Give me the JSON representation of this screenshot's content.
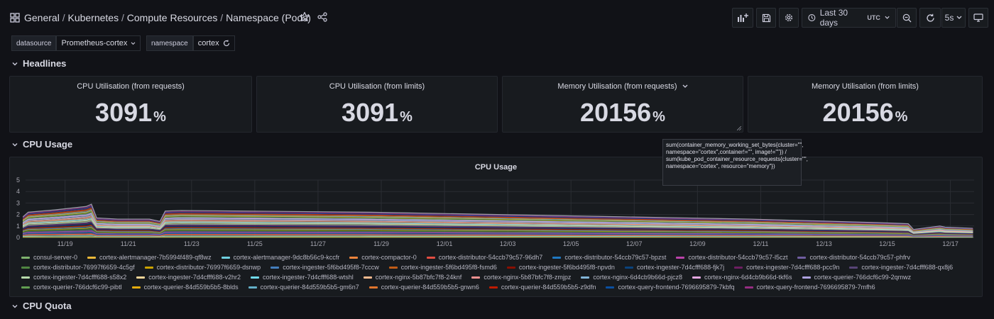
{
  "header": {
    "breadcrumb": [
      "General",
      "Kubernetes",
      "Compute Resources",
      "Namespace (Pods)"
    ],
    "time_range": "Last 30 days",
    "timezone": "UTC",
    "refresh_interval": "5s",
    "icons": [
      "grid-icon",
      "star-icon",
      "share-icon",
      "add-panel-icon",
      "save-icon",
      "settings-icon",
      "clock-icon",
      "zoom-out-icon",
      "refresh-icon",
      "tv-mode-icon"
    ]
  },
  "variables": [
    {
      "label": "datasource",
      "value": "Prometheus-cortex"
    },
    {
      "label": "namespace",
      "value": "cortex"
    }
  ],
  "rows": {
    "headlines": "Headlines",
    "cpu_usage": "CPU Usage",
    "cpu_quota": "CPU Quota"
  },
  "stats": [
    {
      "title": "CPU Utilisation (from requests)",
      "value": "3091",
      "unit": "%"
    },
    {
      "title": "CPU Utilisation (from limits)",
      "value": "3091",
      "unit": "%"
    },
    {
      "title": "Memory Utilisation (from requests)",
      "value": "20156",
      "unit": "%"
    },
    {
      "title": "Memory Utilisation (from limits)",
      "value": "20156",
      "unit": "%"
    }
  ],
  "tooltip": "sum(container_memory_working_set_bytes{cluster=\"\", namespace=\"cortex\",container!=\"\", image!=\"\"}) / sum(kube_pod_container_resource_requests{cluster=\"\", namespace=\"cortex\", resource=\"memory\"})",
  "chart_data": {
    "type": "area",
    "title": "CPU Usage",
    "x_ticks": [
      "11/19",
      "11/21",
      "11/23",
      "11/25",
      "11/27",
      "11/29",
      "12/01",
      "12/03",
      "12/05",
      "12/07",
      "12/09",
      "12/11",
      "12/13",
      "12/15",
      "12/17"
    ],
    "y_ticks": [
      "0",
      "1",
      "2",
      "3",
      "4",
      "5"
    ],
    "ylim": [
      0,
      5
    ],
    "grid": true,
    "legend_position": "bottom",
    "total": {
      "x": [
        "11/18",
        "11/18",
        "11/19",
        "11/20",
        "11/20",
        "11/20",
        "11/21",
        "11/21",
        "11/22",
        "11/22",
        "11/22",
        "11/22",
        "11/23",
        "11/25",
        "11/27",
        "11/29",
        "12/01",
        "12/03",
        "12/05",
        "12/07",
        "12/09",
        "12/11",
        "12/13",
        "12/15",
        "12/16",
        "12/16",
        "12/17",
        "12/17",
        "12/18"
      ],
      "y": [
        1.8,
        2.2,
        2.4,
        2.7,
        2.9,
        1.7,
        1.6,
        1.6,
        1.6,
        1.5,
        1.4,
        2.3,
        2.35,
        2.3,
        2.25,
        2.2,
        2.1,
        2.0,
        1.9,
        1.8,
        1.7,
        1.6,
        1.45,
        1.3,
        1.2,
        0.7,
        1.0,
        0.9,
        0.8
      ]
    },
    "series": [
      {
        "name": "consul-server-0",
        "color": "#7eb26d"
      },
      {
        "name": "cortex-alertmanager-7b5994f489-qf8wz",
        "color": "#eab839"
      },
      {
        "name": "cortex-alertmanager-9dc8b56c9-kccfr",
        "color": "#6ed0e0"
      },
      {
        "name": "cortex-compactor-0",
        "color": "#ef843c"
      },
      {
        "name": "cortex-distributor-54ccb79c57-96dh7",
        "color": "#e24d42"
      },
      {
        "name": "cortex-distributor-54ccb79c57-bpzst",
        "color": "#1f78c1"
      },
      {
        "name": "cortex-distributor-54ccb79c57-l5czt",
        "color": "#ba43a9"
      },
      {
        "name": "cortex-distributor-54ccb79c57-phfrv",
        "color": "#705da0"
      },
      {
        "name": "cortex-distributor-76997f6659-4c5gf",
        "color": "#508642"
      },
      {
        "name": "cortex-distributor-76997f6659-dsnwp",
        "color": "#cca300"
      },
      {
        "name": "cortex-ingester-5f6bd495f8-7cccw",
        "color": "#447ebc"
      },
      {
        "name": "cortex-ingester-5f6bd495f8-fsmd6",
        "color": "#c15c17"
      },
      {
        "name": "cortex-ingester-5f6bd495f8-npvdn",
        "color": "#890f02"
      },
      {
        "name": "cortex-ingester-7d4cfff688-fjk7j",
        "color": "#0a437c"
      },
      {
        "name": "cortex-ingester-7d4cfff688-pcc9n",
        "color": "#6d1f62"
      },
      {
        "name": "cortex-ingester-7d4cfff688-qx8j6",
        "color": "#584477"
      },
      {
        "name": "cortex-ingester-7d4cfff688-s58x2",
        "color": "#b7dbab"
      },
      {
        "name": "cortex-ingester-7d4cfff688-v2hr2",
        "color": "#f4d598"
      },
      {
        "name": "cortex-ingester-7d4cfff688-wtshl",
        "color": "#70dbed"
      },
      {
        "name": "cortex-nginx-5b87bfc7f8-24knf",
        "color": "#f9ba8f"
      },
      {
        "name": "cortex-nginx-5b87bfc7f8-zmjpz",
        "color": "#f29191"
      },
      {
        "name": "cortex-nginx-6d4cb9b66d-pjcz8",
        "color": "#82b5d8"
      },
      {
        "name": "cortex-nginx-6d4cb9b66d-tkf6s",
        "color": "#e5a8e2"
      },
      {
        "name": "cortex-querier-766dcf6c99-2qmwz",
        "color": "#aea2e0"
      },
      {
        "name": "cortex-querier-766dcf6c99-pibtl",
        "color": "#629e51"
      },
      {
        "name": "cortex-querier-84d559b5b5-8blds",
        "color": "#e5ac0e"
      },
      {
        "name": "cortex-querier-84d559b5b5-gm6n7",
        "color": "#64b0c8"
      },
      {
        "name": "cortex-querier-84d559b5b5-gnwn6",
        "color": "#e0752d"
      },
      {
        "name": "cortex-querier-84d559b5b5-z9dfn",
        "color": "#bf1b00"
      },
      {
        "name": "cortex-query-frontend-7696695879-7kbfq",
        "color": "#0a50a1"
      },
      {
        "name": "cortex-query-frontend-7696695879-7mfh6",
        "color": "#962d82"
      }
    ]
  }
}
